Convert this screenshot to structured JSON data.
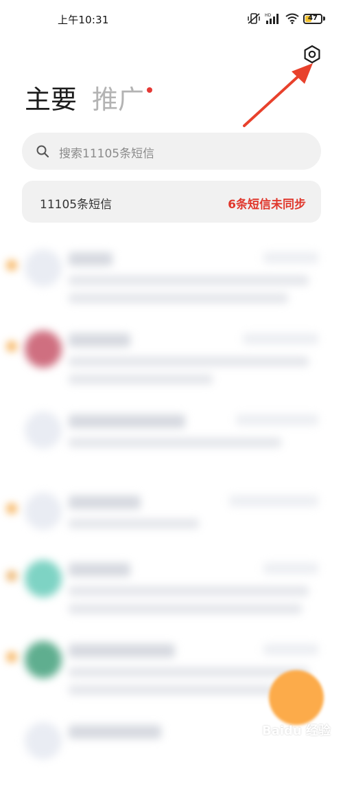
{
  "status_bar": {
    "time": "上午10:31",
    "battery": "47",
    "battery_level": 0.47,
    "icons": [
      "vibrate-silent-icon",
      "hd-signal-icon",
      "wifi-icon",
      "battery-icon"
    ]
  },
  "toolbar": {
    "settings_icon": "gear-icon"
  },
  "tabs": [
    {
      "label": "主要",
      "active": true
    },
    {
      "label": "推广",
      "active": false,
      "has_badge": true
    }
  ],
  "search": {
    "placeholder": "搜索11105条短信"
  },
  "summary": {
    "count_text": "11105条短信",
    "sync_status": "6条短信未同步",
    "sync_color": "#e0372c"
  },
  "watermark": {
    "text": "Baidu 经验"
  },
  "colors": {
    "accent": "#e0372c",
    "fab": "#fcab4a",
    "unread": "#f5a33a",
    "arrow": "#e8412c"
  }
}
